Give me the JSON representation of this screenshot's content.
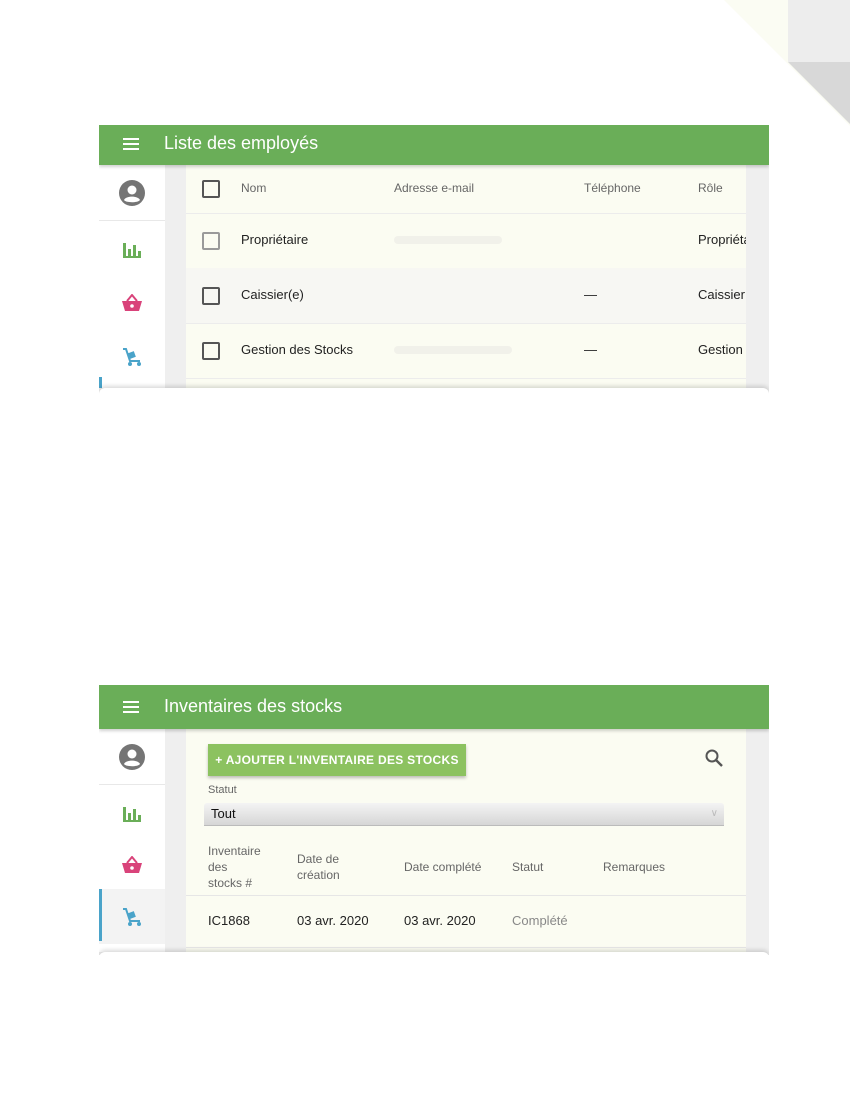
{
  "screen1": {
    "title": "Liste des employés",
    "columns": {
      "name": "Nom",
      "email": "Adresse e-mail",
      "phone": "Téléphone",
      "role": "Rôle"
    },
    "rows": [
      {
        "name": "Propriétaire",
        "email": "",
        "phone": "",
        "role": "Propriéta"
      },
      {
        "name": "Caissier(e)",
        "email": "",
        "phone": "—",
        "role": "Caissier"
      },
      {
        "name": "Gestion des Stocks",
        "email": "",
        "phone": "—",
        "role": "Gestion"
      }
    ]
  },
  "screen2": {
    "title": "Inventaires des stocks",
    "add_button": "+ AJOUTER L'INVENTAIRE DES STOCKS",
    "status_label": "Statut",
    "status_value": "Tout",
    "columns": {
      "inventory": [
        "Inventaire",
        "des",
        "stocks #"
      ],
      "created": [
        "Date de",
        "création"
      ],
      "completed": "Date complété",
      "status": "Statut",
      "notes": "Remarques"
    },
    "rows": [
      {
        "inventory": "IC1868",
        "created": "03 avr. 2020",
        "completed": "03 avr. 2020",
        "status": "Complété",
        "notes": ""
      }
    ]
  },
  "icons": {
    "nav": [
      "account-icon",
      "chart-icon",
      "basket-icon",
      "inventory-cart-icon"
    ],
    "colors": {
      "appbar": "#6aae58",
      "account": "#757575",
      "chart": "#6aae58",
      "basket": "#d9437a",
      "inventory": "#4aa3c9"
    }
  }
}
